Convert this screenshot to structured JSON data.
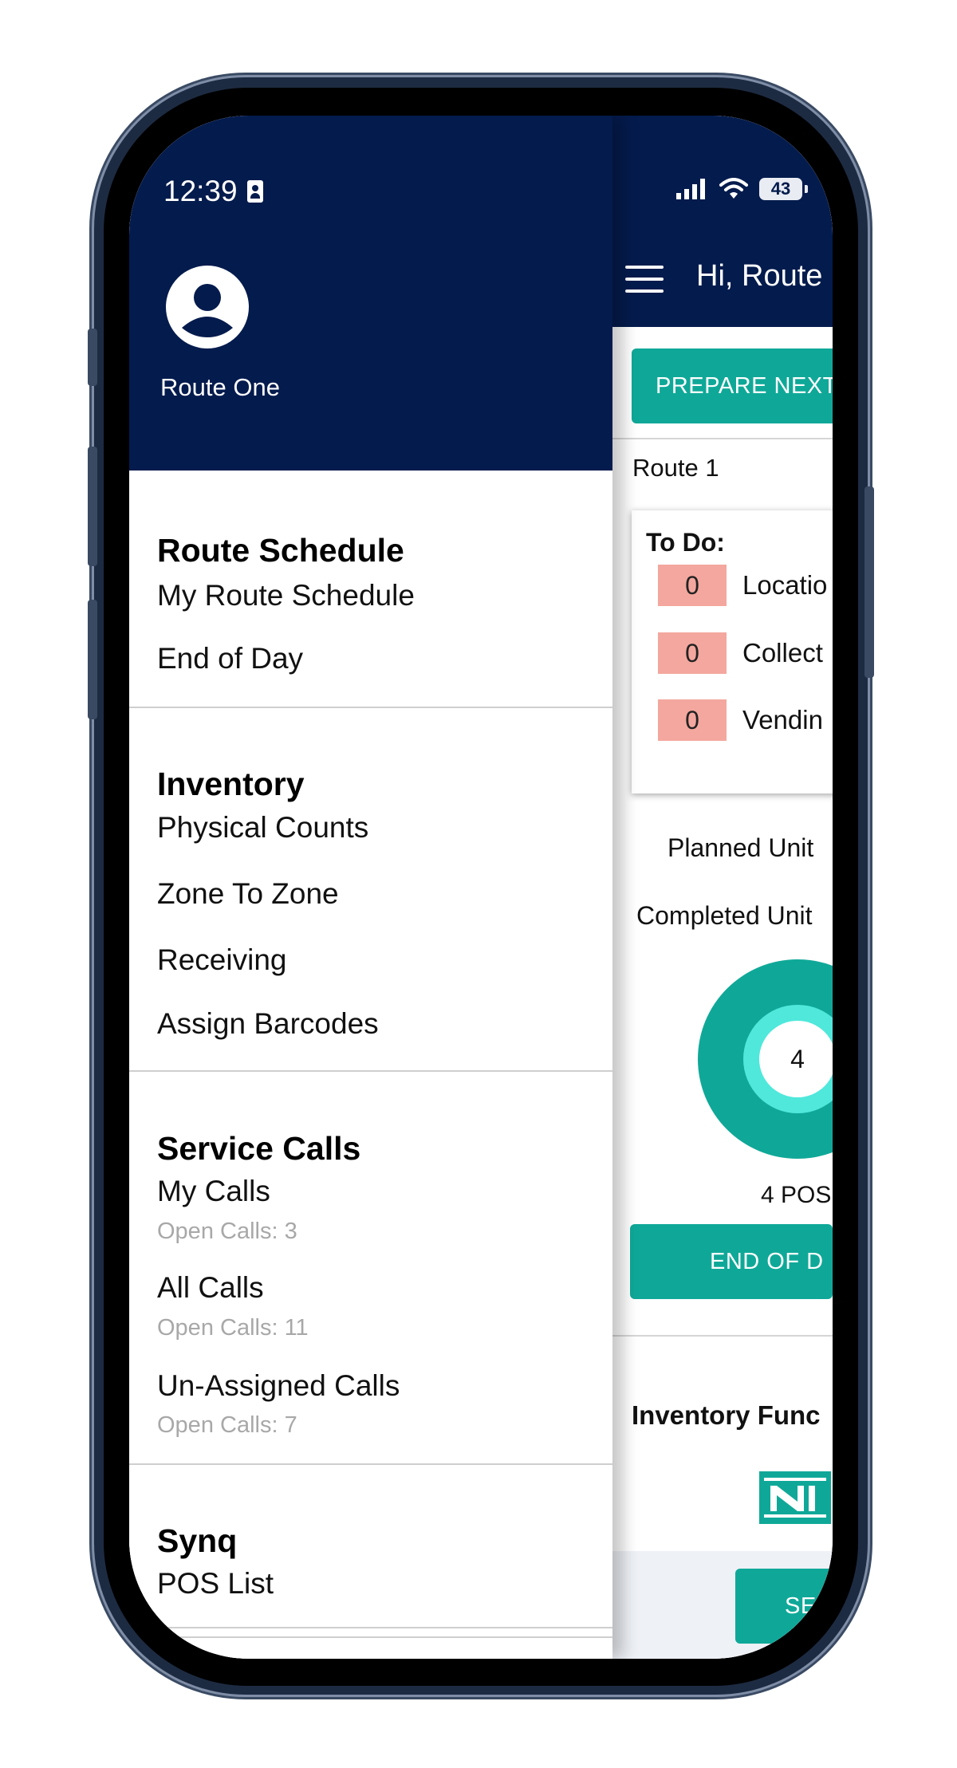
{
  "status_bar": {
    "time": "12:39",
    "battery": "43"
  },
  "drawer": {
    "user_name": "Route One",
    "sections": [
      {
        "title": "Route Schedule",
        "items": [
          {
            "label": "My Route Schedule"
          },
          {
            "label": "End of Day"
          }
        ]
      },
      {
        "title": "Inventory",
        "items": [
          {
            "label": "Physical Counts"
          },
          {
            "label": "Zone To Zone"
          },
          {
            "label": "Receiving"
          },
          {
            "label": "Assign Barcodes"
          }
        ]
      },
      {
        "title": "Service Calls",
        "items": [
          {
            "label": "My Calls",
            "sub": "Open Calls: 3"
          },
          {
            "label": "All Calls",
            "sub": "Open Calls: 11"
          },
          {
            "label": "Un-Assigned Calls",
            "sub": "Open Calls: 7"
          }
        ]
      },
      {
        "title": "Synq",
        "items": [
          {
            "label": "POS List"
          }
        ]
      }
    ]
  },
  "main": {
    "greeting": "Hi, Route",
    "prepare_button": "PREPARE NEXT",
    "route_label": "Route 1",
    "todo": {
      "title": "To Do:",
      "rows": [
        {
          "count": "0",
          "label": "Locatio"
        },
        {
          "count": "0",
          "label": "Collect"
        },
        {
          "count": "0",
          "label": "Vendin"
        }
      ]
    },
    "planned_units": "Planned Unit",
    "completed_units": "Completed Unit",
    "donut_value": "4",
    "pos_label": "4 POS",
    "end_of_day_button": "END OF D",
    "inventory_title": "Inventory Func",
    "send_button": "SEN"
  },
  "colors": {
    "navy": "#041b4d",
    "teal": "#0fa898",
    "count_bg": "#f4a79e"
  }
}
